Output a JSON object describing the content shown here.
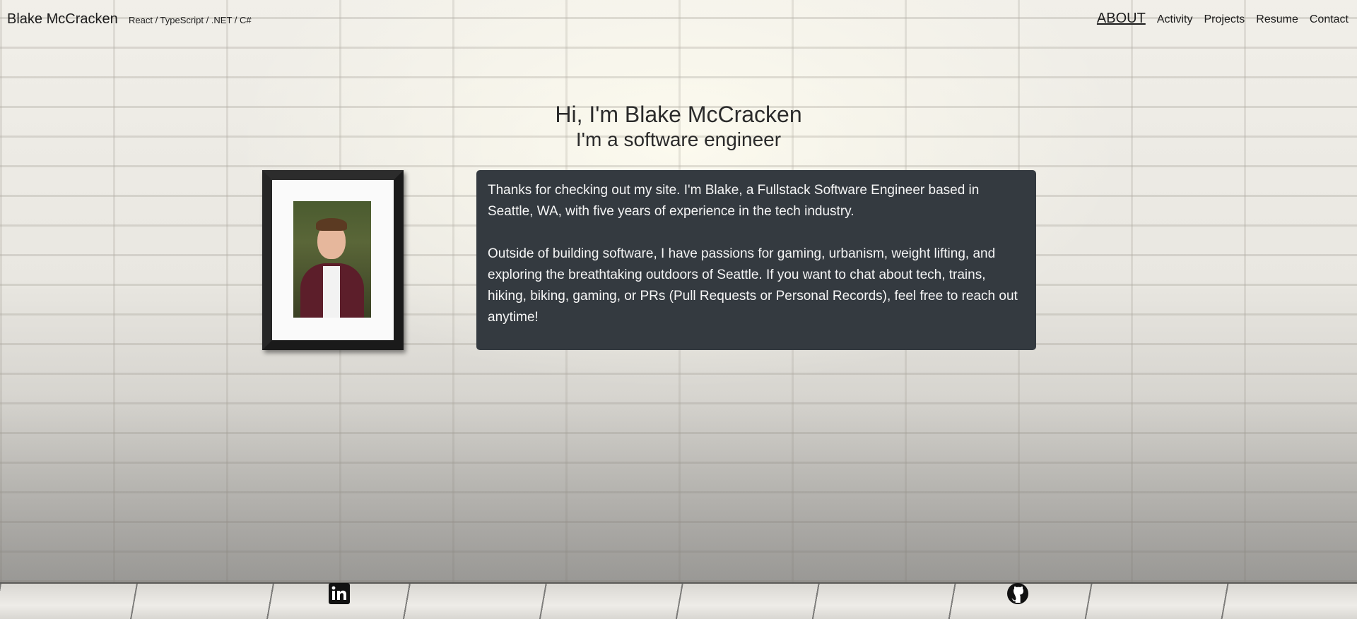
{
  "header": {
    "brand": "Blake McCracken",
    "tagline": "React / TypeScript / .NET / C#",
    "nav": [
      {
        "label": "ABOUT",
        "active": true
      },
      {
        "label": "Activity",
        "active": false
      },
      {
        "label": "Projects",
        "active": false
      },
      {
        "label": "Resume",
        "active": false
      },
      {
        "label": "Contact",
        "active": false
      }
    ]
  },
  "hero": {
    "title": "Hi, I'm Blake McCracken",
    "subtitle": "I'm a software engineer"
  },
  "about": {
    "paragraph1": "Thanks for checking out my site. I'm Blake, a Fullstack Software Engineer based in Seattle, WA, with five years of experience in the tech industry.",
    "paragraph2": "Outside of building software, I have passions for gaming, urbanism, weight lifting, and exploring the breathtaking outdoors of Seattle. If you want to chat about tech, trains, hiking, biking, gaming, or PRs (Pull Requests or Personal Records), feel free to reach out anytime!"
  },
  "footer": {
    "icons": [
      "linkedin-icon",
      "github-icon"
    ]
  },
  "colors": {
    "card_background": "#343a40",
    "text_dark": "#1c1c1c"
  }
}
